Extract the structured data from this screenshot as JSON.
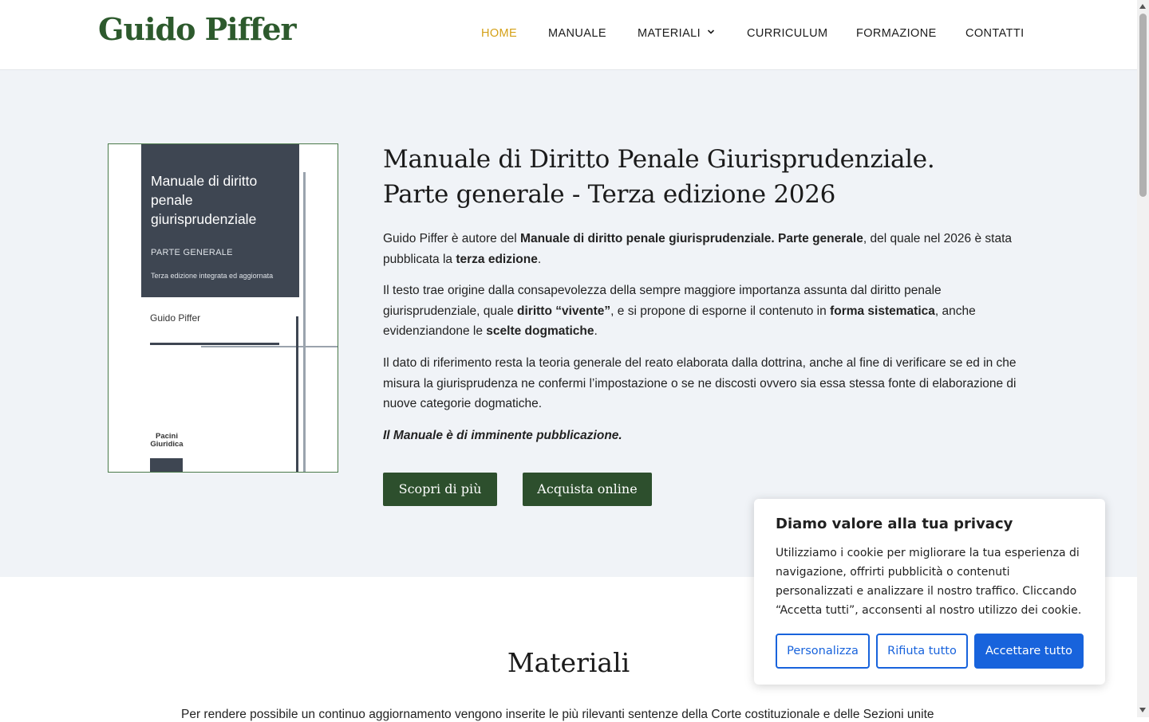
{
  "header": {
    "logo": "Guido Piffer",
    "nav": [
      {
        "label": "HOME",
        "active": true
      },
      {
        "label": "MANUALE"
      },
      {
        "label": "MATERIALI",
        "has_dropdown": true
      },
      {
        "label": "CURRICULUM"
      },
      {
        "label": "FORMAZIONE"
      },
      {
        "label": "CONTATTI"
      }
    ]
  },
  "hero": {
    "book_cover": {
      "title": "Manuale di diritto penale giurisprudenziale",
      "subtitle": "PARTE GENERALE",
      "edition": "Terza edizione integrata ed aggiornata",
      "author": "Guido Piffer",
      "publisher": "Pacini Giuridica"
    },
    "title_line1": "Manuale di Diritto Penale Giurisprudenziale.",
    "title_line2": "Parte generale - Terza edizione 2026",
    "p1": {
      "a": "Guido Piffer è autore del ",
      "b": "Manuale di diritto penale giurisprudenziale. Parte generale",
      "c": ", del quale nel 2026 è stata pubblicata la ",
      "d": "terza edizione",
      "e": "."
    },
    "p2": {
      "a": "Il testo trae origine dalla consapevolezza della sempre maggiore importanza assunta dal diritto penale giurisprudenziale, quale ",
      "b": "diritto “vivente”",
      "c": ", e si propone di esporne il contenuto in ",
      "d": "forma sistematica",
      "e": ", anche evidenziandone le ",
      "f": "scelte dogmatiche",
      "g": "."
    },
    "p3": "Il dato di riferimento resta la teoria generale del reato elaborata dalla dottrina, anche al fine di verificare se ed in che misura la giurisprudenza ne confermi l’impostazione o se ne discosti ovvero sia essa stessa fonte di elaborazione di nuove categorie dogmatiche.",
    "p4": "Il Manuale è di imminente pubblicazione.",
    "btn_discover": "Scopri di più",
    "btn_buy": "Acquista online"
  },
  "materials": {
    "title": "Materiali",
    "text": "Per rendere possibile un continuo aggiornamento vengono inserite le più rilevanti sentenze della Corte costituzionale e delle Sezioni unite"
  },
  "cookie": {
    "title": "Diamo valore alla tua privacy",
    "text": "Utilizziamo i cookie per migliorare la tua esperienza di navigazione, offrirti pubblicità o contenuti personalizzati e analizzare il nostro traffico. Cliccando “Accetta tutti”, acconsenti al nostro utilizzo dei cookie.",
    "btn_customize": "Personalizza",
    "btn_reject": "Rifiuta tutto",
    "btn_accept": "Accettare tutto"
  },
  "colors": {
    "brand_green": "#2d5a2d",
    "nav_active": "#d4a017",
    "hero_bg": "#f0f3f7",
    "cookie_blue": "#1863dc"
  }
}
